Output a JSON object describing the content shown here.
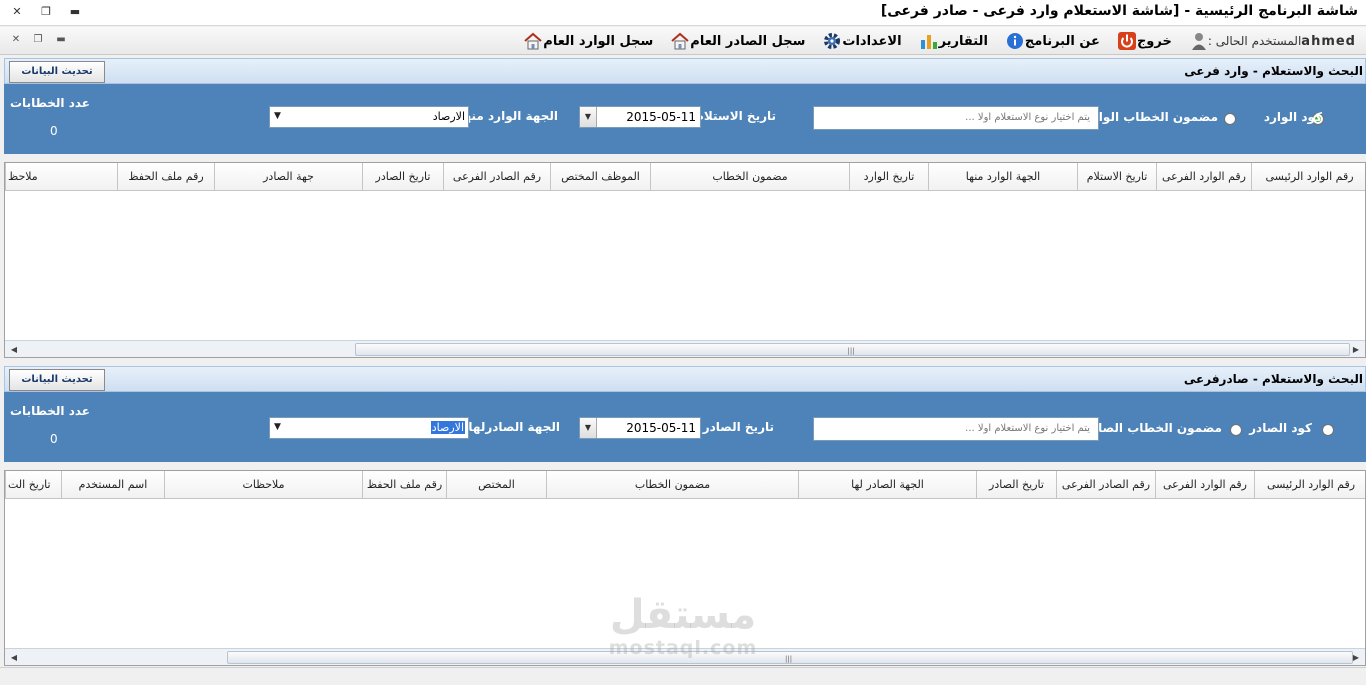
{
  "window": {
    "title": "شاشة البرنامج الرئيسية - [شاشة الاستعلام  وارد فرعى - صادر فرعى]"
  },
  "menu": {
    "items": [
      {
        "label": "سجل الوارد العام",
        "icon": "home-icon"
      },
      {
        "label": "سجل الصادر العام",
        "icon": "home-icon"
      },
      {
        "label": "الاعدادات",
        "icon": "gear-icon"
      },
      {
        "label": "التقارير",
        "icon": "bar-chart-icon"
      },
      {
        "label": "عن البرنامج",
        "icon": "info-icon"
      },
      {
        "label": "خروج",
        "icon": "power-icon"
      }
    ],
    "user_label": "المستخدم الحالى :",
    "user_name": "ahmed"
  },
  "incoming": {
    "header_title": "البحث والاستعلام -  وارد فرعى",
    "refresh_label": "تحديث البيانات",
    "radio_code": "كود الوارد",
    "radio_content": "مضمون الخطاب الوارد",
    "search_placeholder": "يتم اختيار نوع الاستعلام اولا ...",
    "date_label": "تاريخ الاستلام",
    "date_value": "2015-05-11",
    "entity_label": "الجهة الوارد منها",
    "entity_value": "الارصاد",
    "count_label": "عدد الخطابات",
    "count_value": "0",
    "columns": [
      "رقم الوارد الرئيسى",
      "رقم الوارد الفرعى",
      "تاريخ الاستلام",
      "الجهة الوارد منها",
      "تاريخ الوارد",
      "مضمون الخطاب",
      "الموظف المختص",
      "رقم الصادر الفرعى",
      "تاريخ الصادر",
      "جهة الصادر",
      "رقم ملف الحفظ",
      "ملاحظ"
    ]
  },
  "outgoing": {
    "header_title": "البحث والاستعلام -  صادرفرعى",
    "refresh_label": "تحديث البيانات",
    "radio_code": "كود الصادر",
    "radio_content": "مضمون الخطاب الصادر",
    "search_placeholder": "يتم اختيار نوع الاستعلام اولا ...",
    "date_label": "تاريخ الصادر",
    "date_value": "2015-05-11",
    "entity_label": "الجهة الصادرلها",
    "entity_value": "الارصاد",
    "count_label": "عدد الخطابات",
    "count_value": "0",
    "columns": [
      "رقم الوارد الرئيسى",
      "رقم الوارد الفرعى",
      "رقم الصادر الفرعى",
      "تاريخ الصادر",
      "الجهة الصادر لها",
      "مضمون الخطاب",
      "المختص",
      "رقم ملف الحفظ",
      "ملاحظات",
      "اسم المستخدم",
      "تاريخ الت"
    ]
  },
  "watermark": {
    "arabic": "مستقل",
    "latin": "mostaql.com"
  },
  "colors": {
    "panel_blue": "#4d83b8",
    "header_strip": "#cfdff1"
  }
}
